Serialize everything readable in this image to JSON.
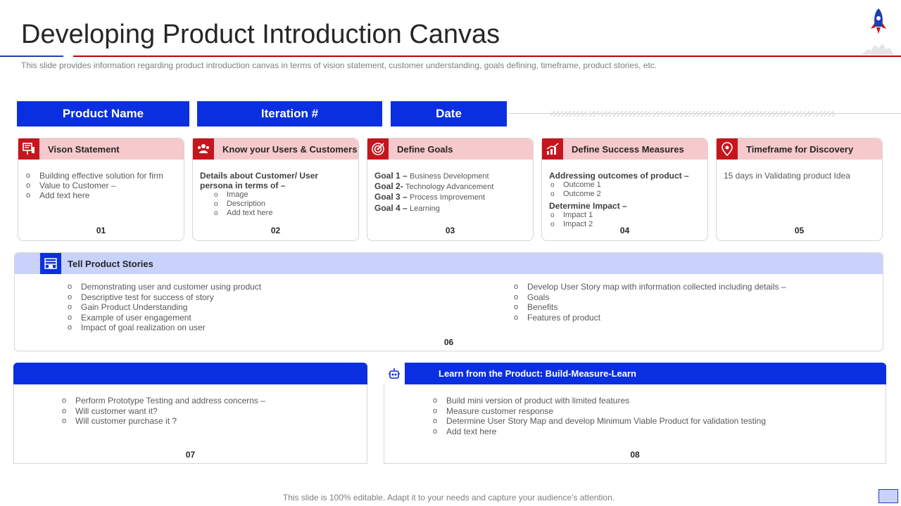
{
  "header": {
    "title": "Developing Product Introduction Canvas",
    "subtitle": "This slide provides information regarding product introduction canvas in terms of vision statement, customer understanding, goals defining, timeframe, product stories, etc."
  },
  "pills": {
    "product_name": "Product Name",
    "iteration": "Iteration #",
    "date": "Date"
  },
  "cards": [
    {
      "title": "Vison Statement",
      "icon": "presentation-icon",
      "items": [
        "Building effective solution for firm",
        "Value to Customer –",
        "Add text here"
      ],
      "number": "01"
    },
    {
      "title": "Know your Users & Customers",
      "icon": "users-icon",
      "heading": "Details about Customer/ User persona in terms of –",
      "items": [
        "Image",
        "Description",
        "Add text here"
      ],
      "number": "02"
    },
    {
      "title": "Define Goals",
      "icon": "target-icon",
      "goals": [
        {
          "label": "Goal 1",
          "sep": " – ",
          "text": "Business Development"
        },
        {
          "label": "Goal 2",
          "sep": "- ",
          "text": "Technology Advancement"
        },
        {
          "label": "Goal 3",
          "sep": " – ",
          "text": "Process Improvement"
        },
        {
          "label": "Goal 4",
          "sep": " – ",
          "text": "Learning"
        }
      ],
      "number": "03"
    },
    {
      "title": "Define Success Measures",
      "icon": "growth-chart-icon",
      "heading1": "Addressing outcomes of product –",
      "items1": [
        "Outcome 1",
        "Outcome 2"
      ],
      "heading2": "Determine Impact –",
      "items2": [
        "Impact 1",
        "Impact 2"
      ],
      "number": "04"
    },
    {
      "title": "Timeframe for Discovery",
      "icon": "location-pin-icon",
      "text": "15 days in Validating product Idea",
      "number": "05"
    }
  ],
  "stories": {
    "title": "Tell Product Stories",
    "icon": "book-stack-icon",
    "left_items": [
      "Demonstrating user and customer using product",
      "Descriptive test for success of story",
      "Gain Product Understanding",
      "Example of user engagement",
      "Impact of goal realization on user"
    ],
    "right_items": [
      "Develop User Story map with information collected including details –",
      "Goals",
      "Benefits",
      "Features of product"
    ],
    "number": "06"
  },
  "panel_left": {
    "title": "",
    "items": [
      "Perform Prototype Testing and address concerns –",
      "Will customer want it?",
      "Will customer purchase it ?"
    ],
    "number": "07"
  },
  "panel_right": {
    "title": "Learn from the Product: Build-Measure-Learn",
    "icon": "robot-icon",
    "items": [
      "Build mini version of product with limited features",
      "Measure customer response",
      "Determine User Story Map and develop Minimum Viable Product for validation testing",
      "Add text here"
    ],
    "number": "08"
  },
  "footer": {
    "text": "This slide is 100% editable. Adapt it to your needs and capture your audience's attention."
  },
  "colors": {
    "primary_blue": "#0a2fe0",
    "accent_red": "#c5161d",
    "card_head_pink": "#f6c9cd",
    "stories_head_lavender": "#c9d2fb"
  }
}
